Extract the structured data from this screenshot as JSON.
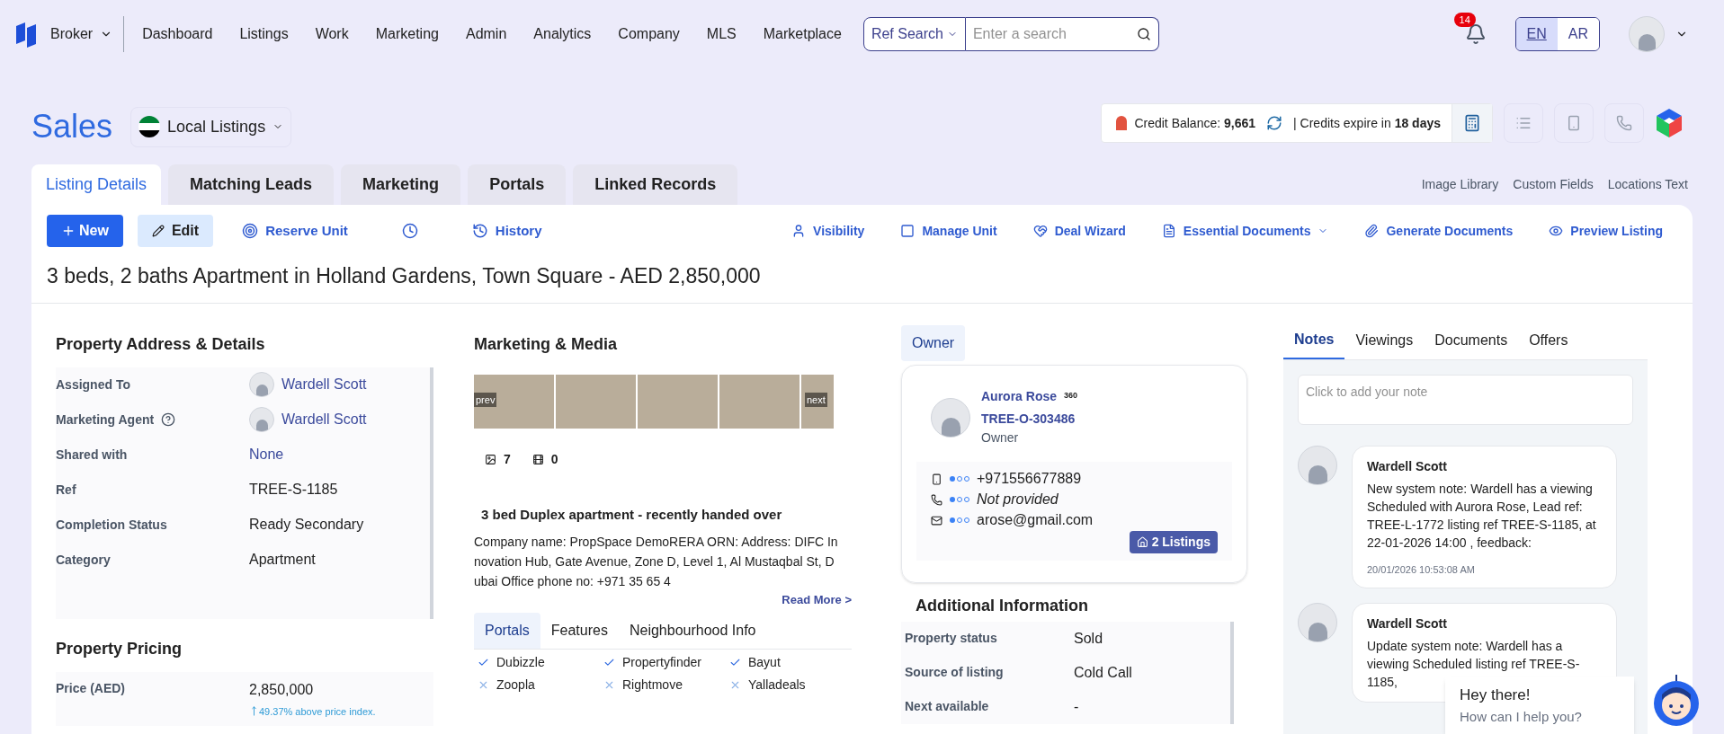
{
  "nav": {
    "role": "Broker",
    "items": [
      "Dashboard",
      "Listings",
      "Work",
      "Marketing",
      "Admin",
      "Analytics",
      "Company",
      "MLS",
      "Marketplace"
    ],
    "search_scope": "Ref Search",
    "search_placeholder": "Enter a search",
    "notification_count": "14",
    "languages": [
      {
        "label": "EN",
        "selected": true
      },
      {
        "label": "AR",
        "selected": false
      }
    ]
  },
  "header": {
    "title": "Sales",
    "market": "Local Listings",
    "credit_label": "Credit Balance:",
    "credit_value": "9,661",
    "separator": "|",
    "expire_label": "Credits expire in",
    "expire_value": "18 days"
  },
  "tabs": [
    {
      "label": "Listing Details",
      "selected": true
    },
    {
      "label": "Matching Leads",
      "selected": false
    },
    {
      "label": "Marketing",
      "selected": false
    },
    {
      "label": "Portals",
      "selected": false
    },
    {
      "label": "Linked Records",
      "selected": false
    }
  ],
  "side_links": [
    "Image Library",
    "Custom Fields",
    "Locations Text"
  ],
  "toolbar": {
    "new": "New",
    "edit": "Edit",
    "actions": [
      {
        "kind": "reserve",
        "label": "Reserve Unit"
      },
      {
        "kind": "clock"
      },
      {
        "kind": "history",
        "label": "History"
      }
    ],
    "right_actions": [
      {
        "kind": "person",
        "label": "Visibility"
      },
      {
        "kind": "square",
        "label": "Manage Unit"
      },
      {
        "kind": "heart",
        "label": "Deal Wizard"
      },
      {
        "kind": "file",
        "label": "Essential Documents"
      },
      {
        "kind": "clip",
        "label": "Generate Documents"
      },
      {
        "kind": "eye",
        "label": "Preview Listing"
      }
    ]
  },
  "listing_title": "3 beds, 2 baths Apartment in Holland Gardens, Town Square - AED 2,850,000",
  "details": {
    "title": "Property Address & Details",
    "rows": [
      {
        "kind": "agent",
        "label": "Assigned To",
        "value": "Wardell Scott",
        "help": false
      },
      {
        "kind": "agent",
        "label": "Marketing Agent",
        "value": "Wardell Scott",
        "help": true
      },
      {
        "kind": "link",
        "label": "Shared with",
        "value": "None",
        "help": false
      },
      {
        "kind": "text",
        "label": "Ref",
        "value": "TREE-S-1185",
        "help": false
      },
      {
        "kind": "text",
        "label": "Completion Status",
        "value": "Ready Secondary",
        "help": false
      },
      {
        "kind": "text",
        "label": "Category",
        "value": "Apartment",
        "help": false
      }
    ]
  },
  "pricing": {
    "title": "Property Pricing",
    "label": "Price (AED)",
    "value": "2,850,000",
    "index_note": "49.37% above price index."
  },
  "media": {
    "title": "Marketing & Media",
    "prev": "prev",
    "next": "next",
    "photo_count": "7",
    "video_count": "0",
    "headline": "3 bed Duplex apartment - recently handed over",
    "description": "Company name: PropSpace DemoRERA ORN: Address: DIFC Innovation Hub, Gate Avenue, Zone D, Level 1, Al Mustaqbal St, Dubai Office phone no: +971 35 65 4",
    "read_more": "Read More >",
    "tabs": [
      {
        "label": "Portals",
        "selected": true
      },
      {
        "label": "Features",
        "selected": false
      },
      {
        "label": "Neighbourhood Info",
        "selected": false
      }
    ],
    "portals": [
      {
        "name": "Dubizzle",
        "checked": true
      },
      {
        "name": "Propertyfinder",
        "checked": true
      },
      {
        "name": "Bayut",
        "checked": true
      },
      {
        "name": "Zoopla",
        "checked": false
      },
      {
        "name": "Rightmove",
        "checked": false
      },
      {
        "name": "Yalladeals",
        "checked": false
      }
    ]
  },
  "owner": {
    "tab": "Owner",
    "name": "Aurora Rose",
    "badge": "360",
    "ref": "TREE-O-303486",
    "role": "Owner",
    "contacts": [
      {
        "kind": "mobile",
        "value": "+971556677889",
        "provided": true
      },
      {
        "kind": "phone",
        "value": "Not provided",
        "provided": false
      },
      {
        "kind": "email",
        "value": "arose@gmail.com",
        "provided": true
      }
    ],
    "listings": "2 Listings"
  },
  "additional": {
    "title": "Additional Information",
    "rows": [
      {
        "label": "Property status",
        "value": "Sold"
      },
      {
        "label": "Source of listing",
        "value": "Cold Call"
      },
      {
        "label": "Next available",
        "value": "-"
      }
    ]
  },
  "notes": {
    "tabs": [
      {
        "label": "Notes",
        "selected": true
      },
      {
        "label": "Viewings",
        "selected": false
      },
      {
        "label": "Documents",
        "selected": false
      },
      {
        "label": "Offers",
        "selected": false
      }
    ],
    "placeholder": "Click to add your note",
    "items": [
      {
        "author": "Wardell Scott",
        "text": "New system note: Wardell has a viewing Scheduled with Aurora Rose, Lead ref: TREE-L-1772 listing ref TREE-S-1185, at 22-01-2026 14:00 , feedback:",
        "time": "20/01/2026 10:53:08 AM"
      },
      {
        "author": "Wardell Scott",
        "text": "Update system note: Wardell has a viewing Scheduled listing ref TREE-S-1185,"
      }
    ]
  },
  "chat": {
    "greeting": "Hey there!",
    "prompt": "How can I help you?"
  }
}
